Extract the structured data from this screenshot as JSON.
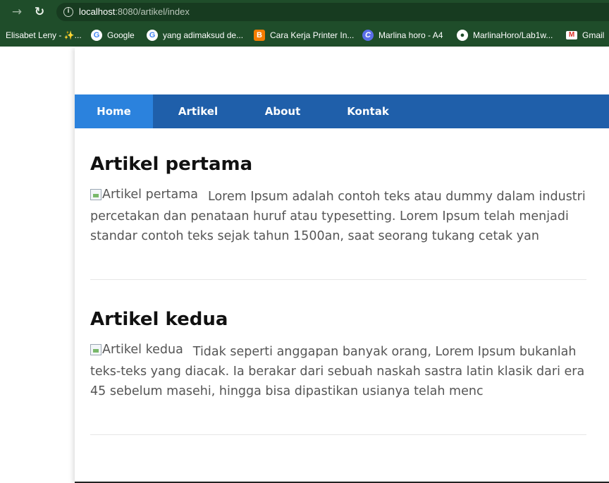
{
  "browser": {
    "url_host": "localhost",
    "url_rest": ":8080/artikel/index",
    "bookmarks": [
      {
        "label": "Elisabet Leny - ✨...",
        "icon": "none"
      },
      {
        "label": "Google",
        "icon": "google-icon"
      },
      {
        "label": "yang adimaksud de...",
        "icon": "google-icon"
      },
      {
        "label": "Cara Kerja Printer In...",
        "icon": "blogger-icon"
      },
      {
        "label": "Marlina horo - A4",
        "icon": "canva-icon"
      },
      {
        "label": "MarlinaHoro/Lab1w...",
        "icon": "github-icon"
      },
      {
        "label": "Gmail",
        "icon": "gmail-icon"
      }
    ]
  },
  "nav": {
    "items": [
      "Home",
      "Artikel",
      "About",
      "Kontak"
    ],
    "active": "Home"
  },
  "articles": [
    {
      "title": "Artikel pertama",
      "image_alt": "Artikel pertama",
      "body": "Lorem Ipsum adalah contoh teks atau dummy dalam industri percetakan dan penataan huruf atau typesetting. Lorem Ipsum telah menjadi standar contoh teks sejak tahun 1500an, saat seorang tukang cetak yan"
    },
    {
      "title": "Artikel kedua",
      "image_alt": "Artikel kedua",
      "body": "Tidak seperti anggapan banyak orang, Lorem Ipsum bukanlah teks-teks yang diacak. Ia berakar dari sebuah naskah sastra latin klasik dari era 45 sebelum masehi, hingga bisa dipastikan usianya telah menc"
    }
  ],
  "colors": {
    "chrome": "#1f4d2a",
    "navbar": "#1f5faa",
    "nav_active": "#2b82dd"
  }
}
